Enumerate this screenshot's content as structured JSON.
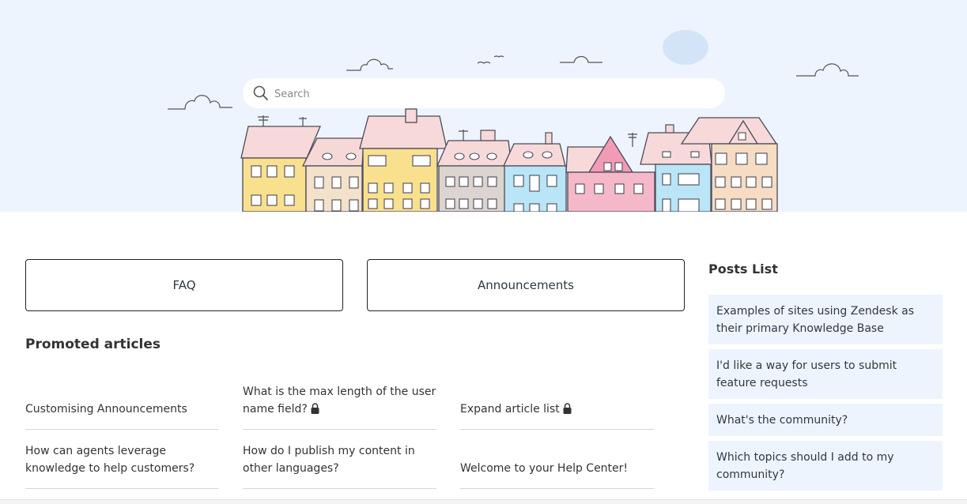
{
  "search": {
    "placeholder": "Search"
  },
  "categories": [
    {
      "label": "FAQ"
    },
    {
      "label": "Announcements"
    }
  ],
  "promoted": {
    "title": "Promoted articles",
    "articles": [
      {
        "title": "Customising Announcements",
        "locked": false
      },
      {
        "title": "What is the max length of the user name field?",
        "locked": true
      },
      {
        "title": "Expand article list",
        "locked": true
      },
      {
        "title": "How can agents leverage knowledge to help customers?",
        "locked": false
      },
      {
        "title": "How do I publish my content in other languages?",
        "locked": false
      },
      {
        "title": "Welcome to your Help Center!",
        "locked": false
      }
    ]
  },
  "posts": {
    "title": "Posts List",
    "items": [
      {
        "title": "Examples of sites using Zendesk as their primary Knowledge Base"
      },
      {
        "title": "I'd like a way for users to submit feature requests"
      },
      {
        "title": "What's the community?"
      },
      {
        "title": "Which topics should I add to my community?"
      }
    ]
  },
  "icons": {
    "search": "search-icon",
    "lock": "lock-icon"
  },
  "colors": {
    "hero_background": "#eef4fd",
    "post_background": "#eef4fd",
    "text": "#2f3941"
  }
}
